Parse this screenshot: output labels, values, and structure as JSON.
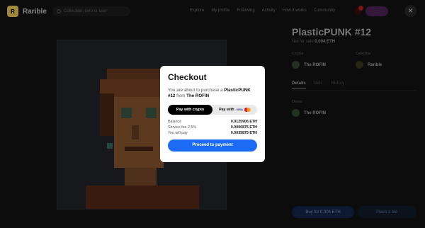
{
  "header": {
    "logo_text": "R",
    "brand": "Rarible",
    "search_placeholder": "Collection, item or user",
    "nav": [
      "Explore",
      "My profile",
      "Following",
      "Activity",
      "How it works",
      "Community"
    ]
  },
  "item": {
    "title": "PlasticPUNK #12",
    "price_prefix": "Not for sale",
    "price_value": "0.004 ETH",
    "creator_label": "Creator",
    "creator_name": "The ROFIN",
    "collection_label": "Collection",
    "collection_name": "Rarible",
    "tabs": [
      "Details",
      "Bids",
      "History"
    ],
    "owner_label": "Owner",
    "owner_name": "The ROFIN",
    "buy_label": "Buy for 0.004 ETH",
    "bid_label": "Place a bid"
  },
  "modal": {
    "title": "Checkout",
    "desc_prefix": "You are about to purchase a",
    "item_name": "PlasticPUNK #12",
    "desc_from": "from",
    "seller": "The ROFIN",
    "tab_crypto": "Pay with crypto",
    "tab_card": "Pay with",
    "visa": "VISA",
    "rows": [
      {
        "label": "Balance",
        "value": "0.0125906 ETH"
      },
      {
        "label": "Service fee 2.5%",
        "value": "0.0000875 ETH"
      },
      {
        "label": "You will pay",
        "value": "0.0035875 ETH"
      }
    ],
    "proceed_label": "Proceed to payment"
  },
  "colors": {
    "accent": "#1c6bf5",
    "logo": "#f4d35e",
    "mastercard_red": "#eb001b",
    "mastercard_orange": "#f79e1b"
  }
}
